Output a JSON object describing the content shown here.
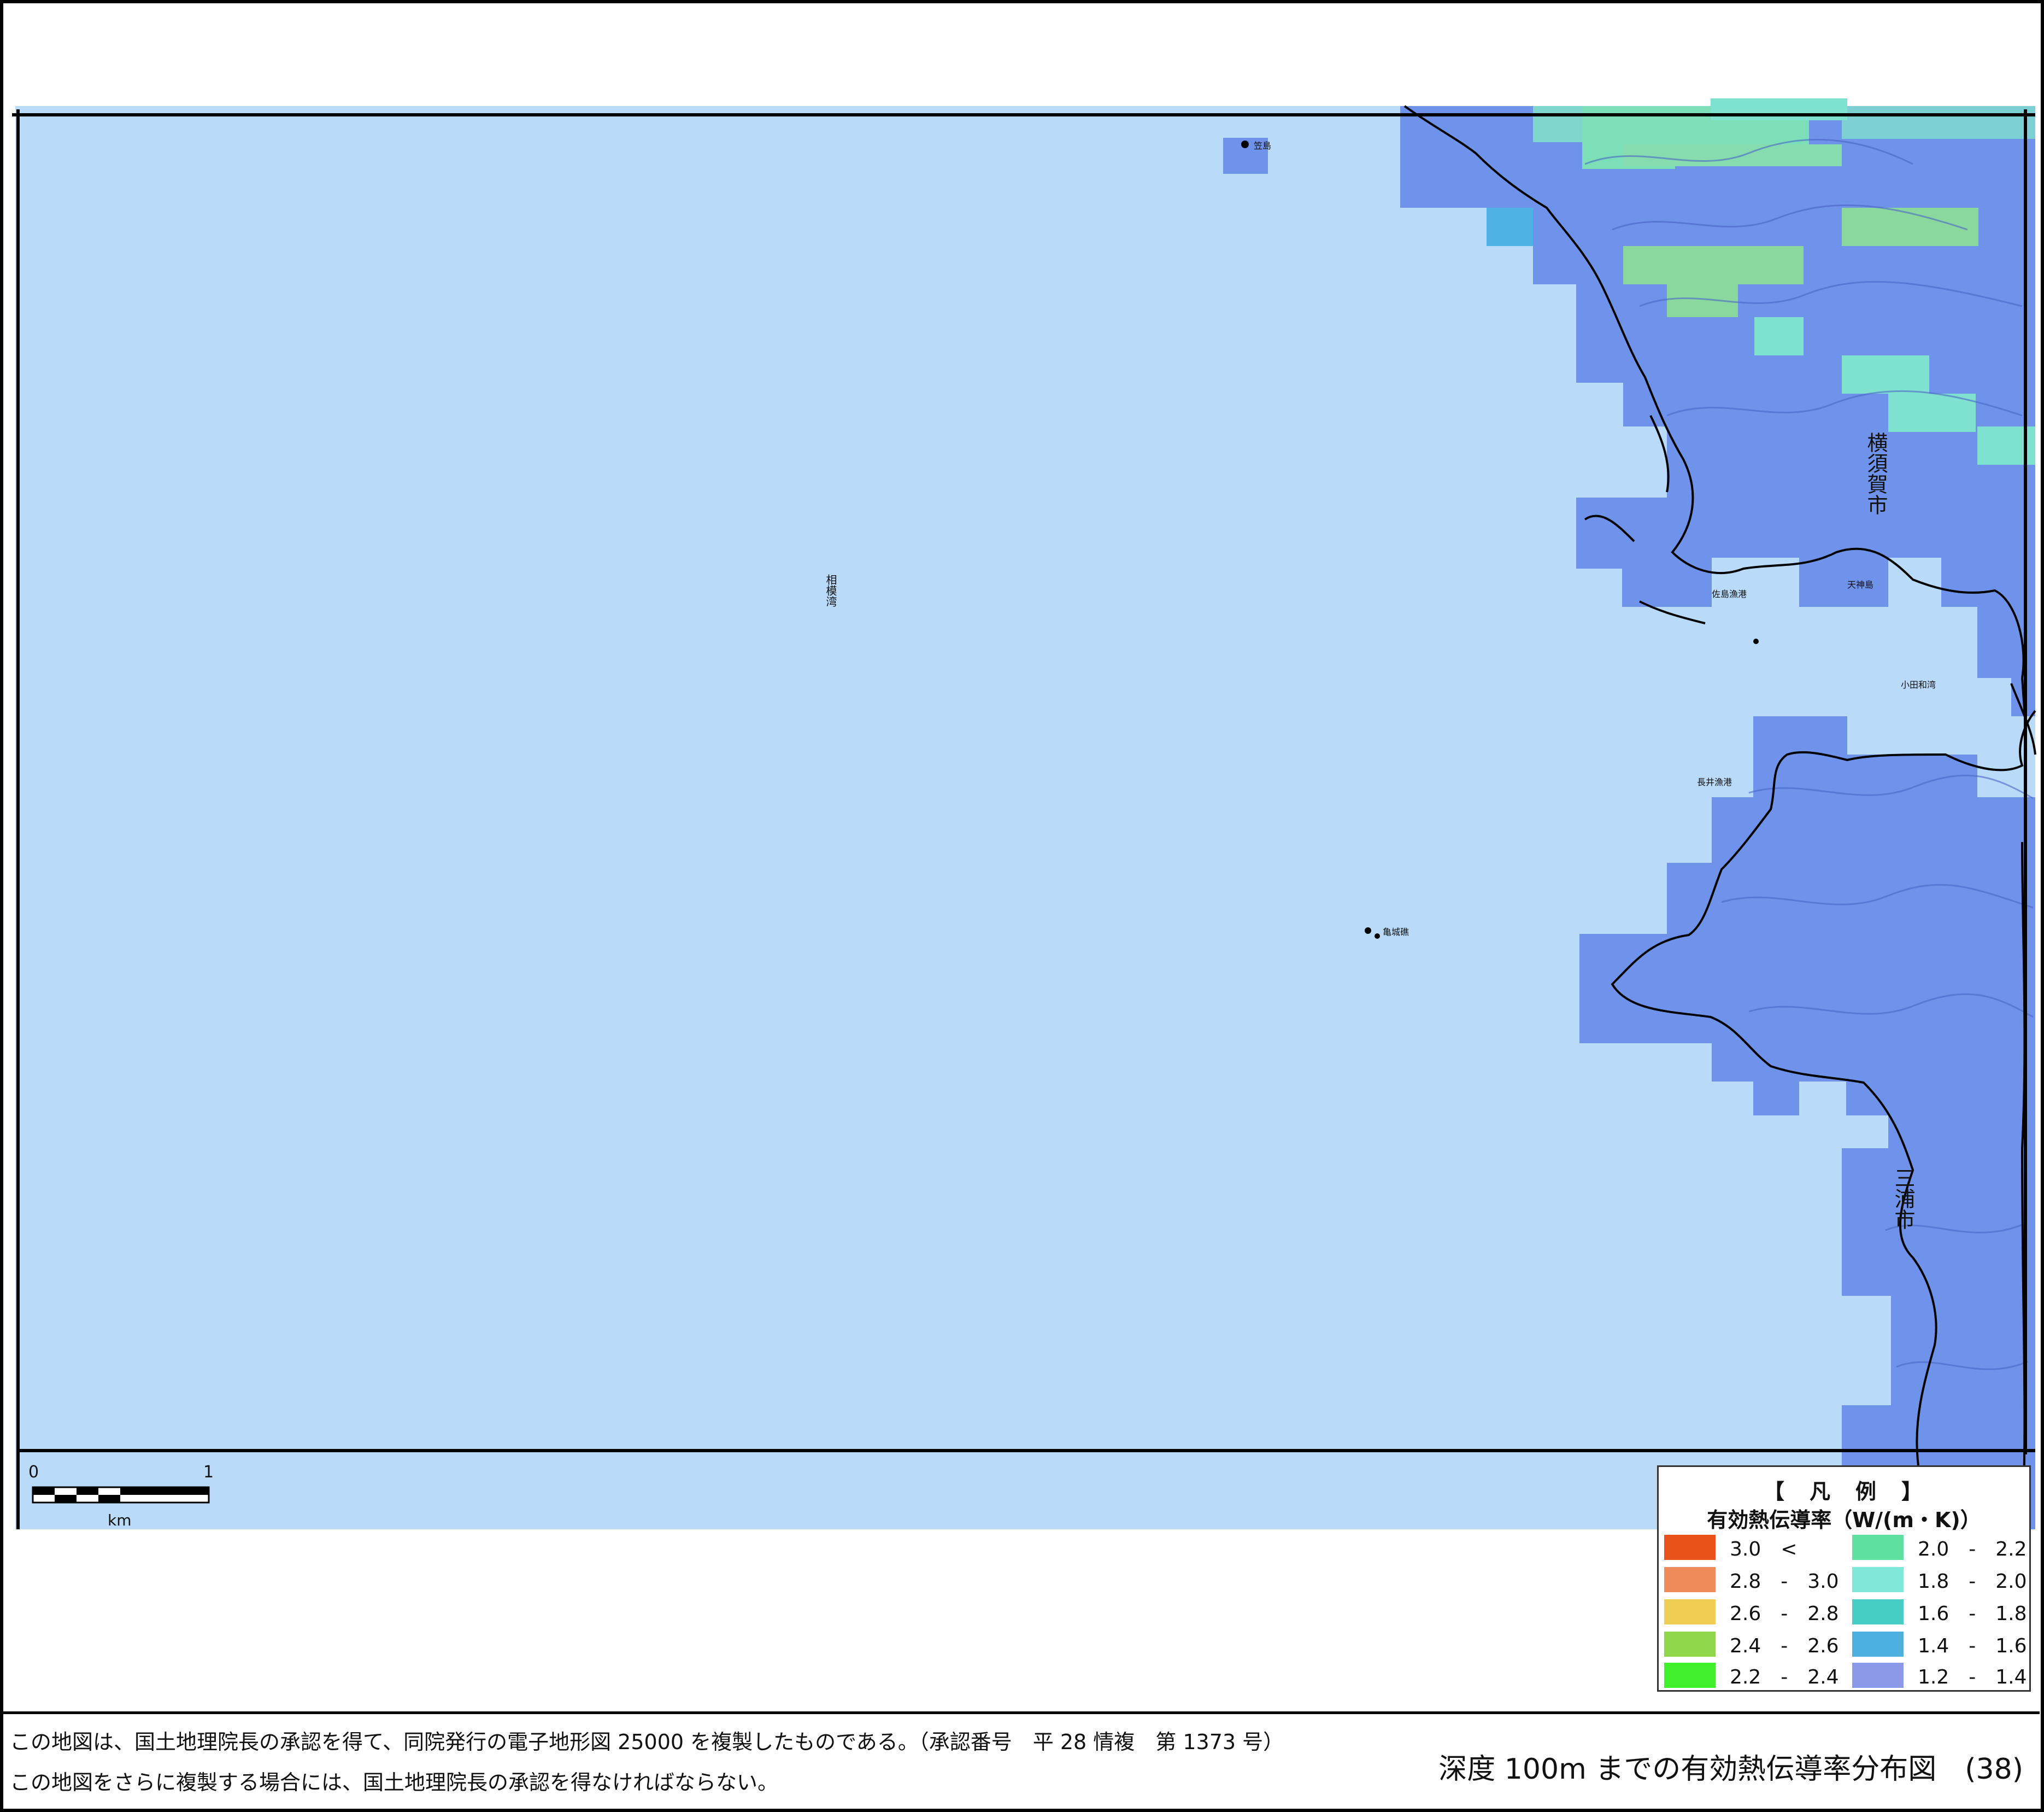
{
  "map": {
    "labels": {
      "sea_name": "相模湾",
      "island_north": "笠島",
      "city_yokosuka": "横須賀市",
      "city_miura": "三浦市",
      "bay_kowada": "小田和湾",
      "port_saga": "佐島漁港",
      "port_nagai": "長井漁港",
      "island_tenjin": "天神島",
      "reef": "亀城礁"
    },
    "colors": {
      "sea": "#b9daf9",
      "land_class_1_2_1_4": "#6f93ea",
      "cell_1_4_1_6": "#4fb1e6",
      "cell_1_8_2_0": "#7fe1cf",
      "cell_2_0_2_2": "#8bd89e",
      "coastline": "#000000"
    }
  },
  "scalebar": {
    "start_label": "0",
    "end_label": "1",
    "unit": "km"
  },
  "legend": {
    "heading": "【　凡　例　】",
    "title": "有効熱伝導率（W/(m・K)）",
    "items": [
      {
        "label": "3.0　<",
        "color": "#e8521b"
      },
      {
        "label": "2.8　-　3.0",
        "color": "#ef8a5b"
      },
      {
        "label": "2.6　-　2.8",
        "color": "#f0cd55"
      },
      {
        "label": "2.4　-　2.6",
        "color": "#8fd64a"
      },
      {
        "label": "2.2　-　2.4",
        "color": "#3ff02a"
      },
      {
        "label": "2.0　-　2.2",
        "color": "#5ee0a0"
      },
      {
        "label": "1.8　-　2.0",
        "color": "#7fe8d8"
      },
      {
        "label": "1.6　-　1.8",
        "color": "#46cdc4"
      },
      {
        "label": "1.4　-　1.6",
        "color": "#4db0df"
      },
      {
        "label": "1.2　-　1.4",
        "color": "#8b9ae8"
      }
    ]
  },
  "footer": {
    "note1": "この地図は、国土地理院長の承認を得て、同院発行の電子地形図 25000 を複製したものである。（承認番号　平 28 情複　第 1373 号）",
    "note2": "この地図をさらに複製する場合には、国土地理院長の承認を得なければならない。",
    "title": "深度 100m までの有効熱伝導率分布図　(38)"
  }
}
